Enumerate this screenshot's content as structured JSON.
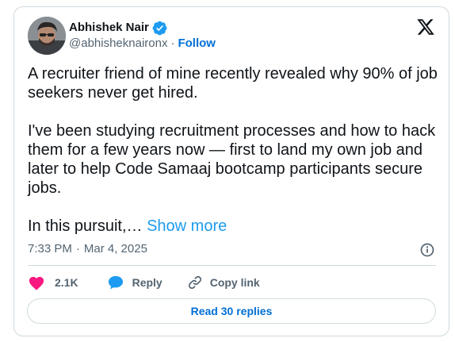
{
  "author": {
    "name": "Abhishek Nair",
    "handle": "@abhisheknaironx",
    "separator": "·",
    "follow_label": "Follow",
    "verified": true
  },
  "tweet": {
    "paragraph1": "A recruiter friend of mine recently revealed why 90% of job seekers never get hired.",
    "paragraph2": "I've been studying recruitment processes and how to hack them for a few years now — first to land my own job and later to help Code Samaaj bootcamp participants secure jobs.",
    "paragraph3": "In this pursuit,…",
    "show_more_label": "Show more"
  },
  "meta": {
    "time": "7:33 PM",
    "separator": "·",
    "date": "Mar 4, 2025"
  },
  "actions": {
    "like_count": "2.1K",
    "reply_label": "Reply",
    "copy_link_label": "Copy link"
  },
  "footer": {
    "read_replies_label": "Read 30 replies"
  },
  "colors": {
    "accent": "#1d9bf0",
    "link": "#006fd6",
    "like": "#f91880",
    "muted": "#536471",
    "border": "#cfd9de"
  },
  "icons": [
    "verified-badge-icon",
    "x-logo-icon",
    "info-icon",
    "heart-icon",
    "reply-bubble-icon",
    "link-icon"
  ]
}
